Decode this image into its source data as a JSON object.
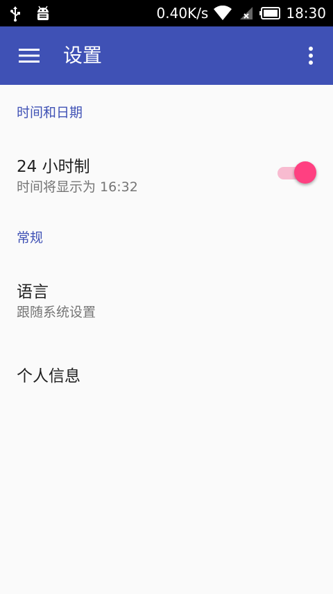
{
  "status_bar": {
    "speed": "0.40K/s",
    "time": "18:30",
    "icons": [
      "usb-icon",
      "android-debug-icon",
      "wifi-icon",
      "signal-icon",
      "battery-icon"
    ]
  },
  "app_bar": {
    "title": "设置",
    "color": "#3f51b5"
  },
  "sections": {
    "datetime": {
      "header": "时间和日期",
      "hour24": {
        "title": "24 小时制",
        "summary": "时间将显示为 16:32",
        "enabled": true
      }
    },
    "general": {
      "header": "常规",
      "language": {
        "title": "语言",
        "summary": "跟随系统设置"
      },
      "personal": {
        "title": "个人信息"
      }
    }
  },
  "colors": {
    "accent": "#ff4081",
    "accent_light": "#f8bbd0",
    "primary": "#3f51b5"
  }
}
